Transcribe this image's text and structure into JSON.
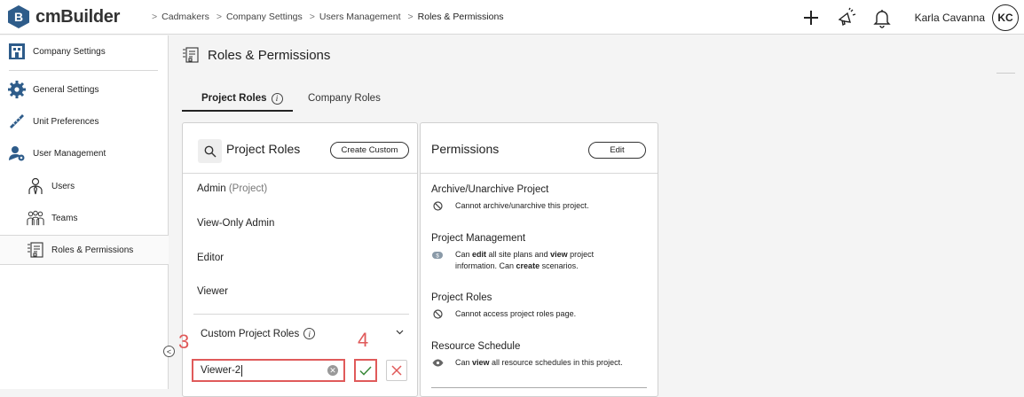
{
  "header": {
    "logo_letter": "B",
    "logo_text": "cmBuilder",
    "breadcrumbs": [
      "Cadmakers",
      "Company Settings",
      "Users Management",
      "Roles & Permissions"
    ],
    "breadcrumb_separator": ">",
    "user_name": "Karla Cavanna",
    "user_initials": "KC"
  },
  "sidebar": {
    "items": [
      {
        "label": "Company Settings",
        "icon": "building-icon"
      },
      {
        "label": "General Settings",
        "icon": "gear-icon"
      },
      {
        "label": "Unit Preferences",
        "icon": "ruler-icon"
      },
      {
        "label": "User Management",
        "icon": "user-gear-icon"
      },
      {
        "label": "Users",
        "icon": "user-icon"
      },
      {
        "label": "Teams",
        "icon": "team-icon"
      },
      {
        "label": "Roles & Permissions",
        "icon": "roles-icon"
      }
    ],
    "collapse_glyph": "<"
  },
  "page": {
    "title": "Roles & Permissions",
    "tabs": [
      {
        "label": "Project Roles",
        "active": true
      },
      {
        "label": "Company Roles",
        "active": false
      }
    ],
    "info_glyph": "i"
  },
  "roles_panel": {
    "title": "Project Roles",
    "create_button": "Create Custom",
    "roles": [
      {
        "name": "Admin",
        "suffix": "(Project)"
      },
      {
        "name": "View-Only Admin",
        "suffix": ""
      },
      {
        "name": "Editor",
        "suffix": ""
      },
      {
        "name": "Viewer",
        "suffix": ""
      }
    ],
    "custom_section": "Custom Project Roles",
    "edit_input_value": "Viewer-2",
    "step_labels": [
      "3",
      "4"
    ]
  },
  "permissions_panel": {
    "title": "Permissions",
    "edit_button": "Edit",
    "groups": [
      {
        "name": "Archive/Unarchive Project",
        "icon": "ban-icon",
        "line1": "Cannot archive/unarchive this project.",
        "line2": ""
      },
      {
        "name": "Project Management",
        "icon": "dollar-badge-icon",
        "line1_parts": [
          "Can ",
          "edit",
          " all site plans and ",
          "view",
          " project"
        ],
        "line2_parts": [
          "information. Can ",
          "create",
          " scenarios."
        ]
      },
      {
        "name": "Project Roles",
        "icon": "ban-icon",
        "line1": "Cannot access project roles page.",
        "line2": ""
      },
      {
        "name": "Resource Schedule",
        "icon": "eye-icon",
        "line1_parts": [
          "Can ",
          "view",
          " all resource schedules in this project."
        ]
      }
    ]
  },
  "colors": {
    "highlight": "#e05a5a",
    "logo_blue": "#2e5c8a",
    "confirm_check": "#3a8a3a",
    "cancel_x": "#e05a5a"
  }
}
